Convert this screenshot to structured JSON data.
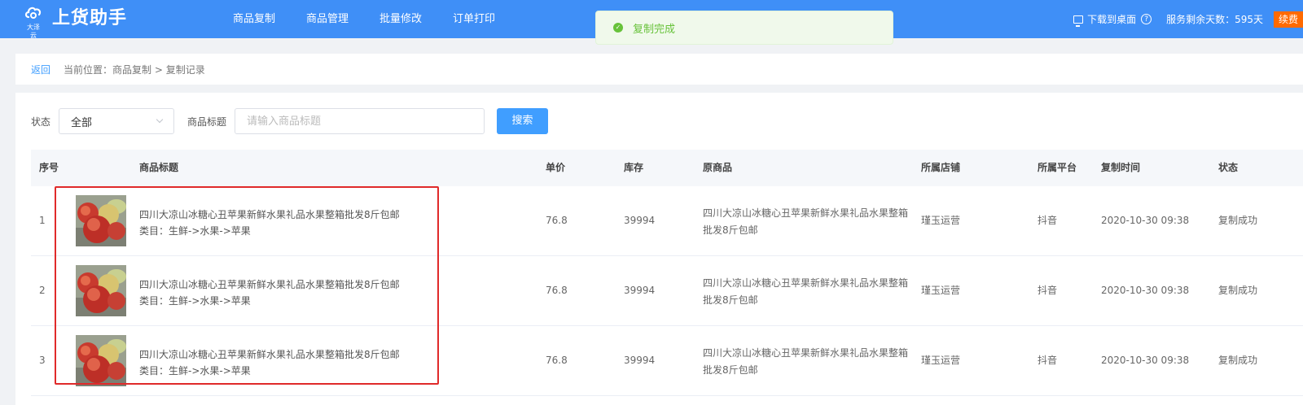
{
  "header": {
    "logo_sub": "大泽云",
    "app_title": "上货助手",
    "nav": [
      "商品复制",
      "商品管理",
      "批量修改",
      "订单打印"
    ],
    "download_label": "下载到桌面",
    "days_left_label": "服务剩余天数：595天",
    "renew_label": "续费"
  },
  "toast": {
    "text": "复制完成"
  },
  "breadcrumb": {
    "back_label": "返回",
    "location": "当前位置：商品复制 > 复制记录"
  },
  "filter": {
    "status_label": "状态",
    "status_value": "全部",
    "title_label": "商品标题",
    "title_placeholder": "请输入商品标题",
    "search_label": "搜索"
  },
  "table": {
    "headers": [
      "序号",
      "商品标题",
      "单价",
      "库存",
      "原商品",
      "所属店铺",
      "所属平台",
      "复制时间",
      "状态"
    ],
    "rows": [
      {
        "index": "1",
        "title": "四川大凉山冰糖心丑苹果新鲜水果礼品水果整箱批发8斤包邮",
        "category": "类目：生鲜->水果->苹果",
        "price": "76.8",
        "stock": "39994",
        "original": "四川大凉山冰糖心丑苹果新鲜水果礼品水果整箱批发8斤包邮",
        "shop": "瑾玉运营",
        "platform": "抖音",
        "time": "2020-10-30 09:38",
        "status": "复制成功"
      },
      {
        "index": "2",
        "title": "四川大凉山冰糖心丑苹果新鲜水果礼品水果整箱批发8斤包邮",
        "category": "类目：生鲜->水果->苹果",
        "price": "76.8",
        "stock": "39994",
        "original": "四川大凉山冰糖心丑苹果新鲜水果礼品水果整箱批发8斤包邮",
        "shop": "瑾玉运营",
        "platform": "抖音",
        "time": "2020-10-30 09:38",
        "status": "复制成功"
      },
      {
        "index": "3",
        "title": "四川大凉山冰糖心丑苹果新鲜水果礼品水果整箱批发8斤包邮",
        "category": "类目：生鲜->水果->苹果",
        "price": "76.8",
        "stock": "39994",
        "original": "四川大凉山冰糖心丑苹果新鲜水果礼品水果整箱批发8斤包邮",
        "shop": "瑾玉运营",
        "platform": "抖音",
        "time": "2020-10-30 09:38",
        "status": "复制成功"
      }
    ]
  },
  "colors": {
    "header": "#3f8ff7",
    "primary": "#409eff",
    "success": "#67c23a",
    "renew": "#ff6a00",
    "highlight": "#e02a2a"
  }
}
